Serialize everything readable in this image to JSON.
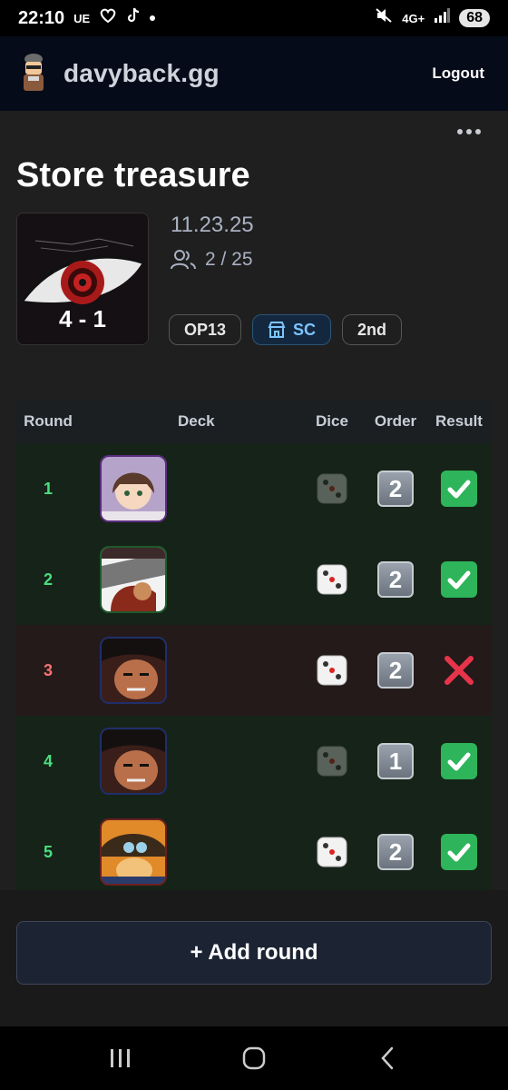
{
  "status_bar": {
    "time": "22:10",
    "carrier": "UE",
    "network": "4G+",
    "battery": "68"
  },
  "app": {
    "brand": "davyback.gg",
    "logout_label": "Logout"
  },
  "event": {
    "title": "Store treasure",
    "date": "11.23.25",
    "players": "2 / 25",
    "score": "4 - 1",
    "tags": [
      "OP13",
      "SC",
      "2nd"
    ]
  },
  "table": {
    "headers": {
      "round": "Round",
      "deck": "Deck",
      "dice": "Dice",
      "order": "Order",
      "result": "Result"
    },
    "rows": [
      {
        "round": "1",
        "dice": "lost",
        "order": "2",
        "result": "win"
      },
      {
        "round": "2",
        "dice": "won",
        "order": "2",
        "result": "win"
      },
      {
        "round": "3",
        "dice": "won",
        "order": "2",
        "result": "loss"
      },
      {
        "round": "4",
        "dice": "lost",
        "order": "1",
        "result": "win"
      },
      {
        "round": "5",
        "dice": "won",
        "order": "2",
        "result": "win"
      }
    ]
  },
  "actions": {
    "add_round_label": "+ Add round"
  },
  "colors": {
    "win_text": "#4ade80",
    "loss_text": "#f87171",
    "accent_sc": "#7cc4ff",
    "appbar_bg": "#060b1a"
  }
}
